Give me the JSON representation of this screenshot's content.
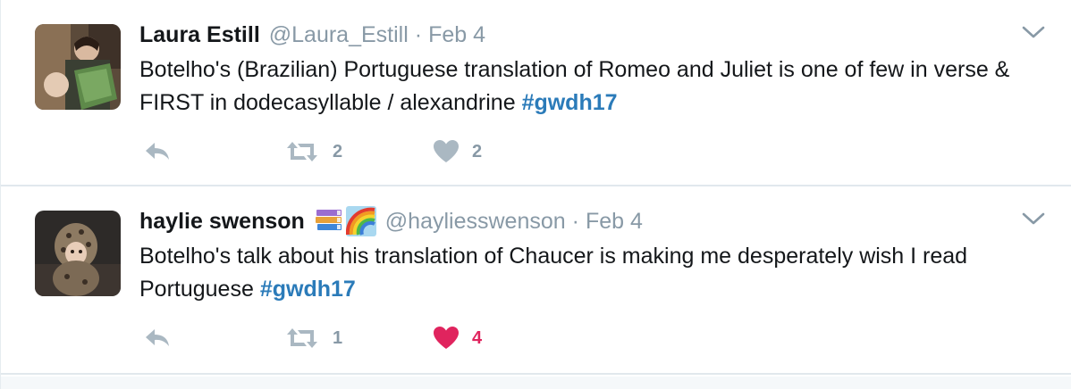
{
  "colors": {
    "name": "#14171a",
    "muted": "#8899a6",
    "hashtag": "#2b7bb9",
    "liked": "#e0245e",
    "divider": "#e1e8ed"
  },
  "tweets": [
    {
      "name": "Laura Estill",
      "handle": "@Laura_Estill",
      "separator": "·",
      "date": "Feb 4",
      "text": "Botelho's (Brazilian) Portuguese translation of Romeo and Juliet is one of few in verse & FIRST in dodecasyllable / alexandrine ",
      "hashtag": "#gwdh17",
      "retweets": "2",
      "likes": "2",
      "liked": false
    },
    {
      "name": "haylie swenson",
      "emoji": [
        "books-emoji",
        "rainbow-emoji"
      ],
      "handle": "@hayliesswenson",
      "separator": "·",
      "date": "Feb 4",
      "text": "Botelho's talk about his translation of Chaucer is making me desperately wish I read Portuguese ",
      "hashtag": "#gwdh17",
      "retweets": "1",
      "likes": "4",
      "liked": true
    }
  ]
}
